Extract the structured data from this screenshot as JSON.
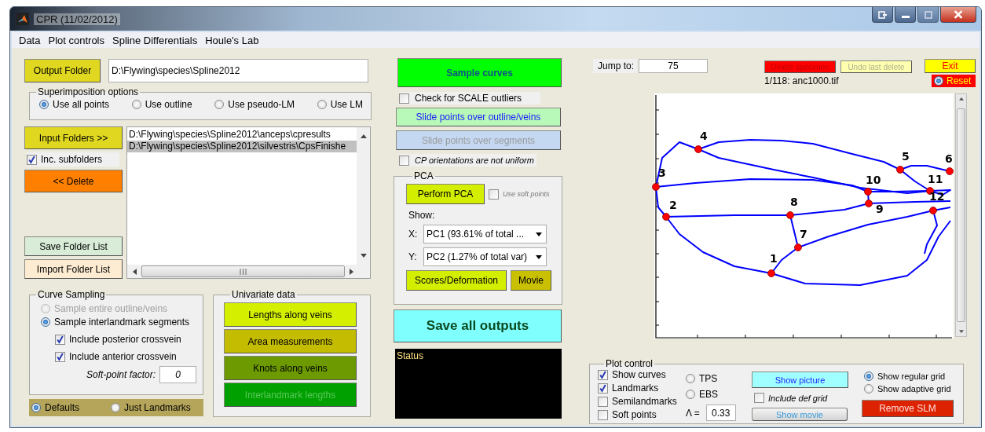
{
  "window": {
    "title": "CPR (11/02/2012)"
  },
  "menu": [
    "Data",
    "Plot controls",
    "Spline Differentials",
    "Houle's Lab"
  ],
  "output_folder": {
    "button": "Output Folder",
    "value": "D:\\Flywing\\species\\Spline2012"
  },
  "superimposition": {
    "title": "Superimposition options",
    "options": [
      {
        "label": "Use all points",
        "selected": true
      },
      {
        "label": "Use outline",
        "selected": false
      },
      {
        "label": "Use pseudo-LM",
        "selected": false
      },
      {
        "label": "Use LM",
        "selected": false
      }
    ]
  },
  "folders": {
    "input_button": "Input Folders >>",
    "subfolders": {
      "label": "Inc. subfolders",
      "checked": true
    },
    "delete_button": "<< Delete",
    "save_button": "Save Folder List",
    "import_button": "Import Folder List",
    "list": [
      {
        "path": "D:\\Flywing\\species\\Spline2012\\anceps\\cpresults",
        "selected": false
      },
      {
        "path": "D:\\Flywing\\species\\Spline2012\\silvestris\\CpsFinishe",
        "selected": true
      }
    ]
  },
  "curve_sampling": {
    "title": "Curve Sampling",
    "options": [
      {
        "label": "Sample entire outline/veins",
        "selected": false,
        "disabled": true
      },
      {
        "label": "Sample interlandmark segments",
        "selected": true,
        "disabled": false
      }
    ],
    "checks": [
      {
        "label": "Include posterior crossvein",
        "checked": true
      },
      {
        "label": "Include anterior crossvein",
        "checked": true
      }
    ],
    "soft_point_factor": {
      "label": "Soft-point factor:",
      "value": "0"
    },
    "presets": [
      {
        "label": "Defaults",
        "selected": true
      },
      {
        "label": "Just Landmarks",
        "selected": false
      }
    ]
  },
  "univariate": {
    "title": "Univariate data",
    "buttons": [
      {
        "label": "Lengths along veins",
        "color": "#d4f000",
        "disabled": false
      },
      {
        "label": "Area measurements",
        "color": "#c4bc00",
        "disabled": false
      },
      {
        "label": "Knots along veins",
        "color": "#6c9a00",
        "disabled": false
      },
      {
        "label": "Interlandmark lengths",
        "color": "#00a000",
        "disabled": true
      }
    ]
  },
  "sample_curves": "Sample curves",
  "scale_check": {
    "label": "Check for SCALE outliers",
    "checked": false
  },
  "slide_outline": {
    "label": "Slide points over outline/veins",
    "disabled": false
  },
  "slide_segments": {
    "label": "Slide points over segments",
    "disabled": true
  },
  "cp_check": {
    "label": "CP orientations are not uniform",
    "checked": false
  },
  "pca": {
    "title": "PCA",
    "perform": "Perform PCA",
    "soft_points": {
      "label": "Use soft points",
      "checked": false
    },
    "show_label": "Show:",
    "x": {
      "label": "X:",
      "value": "PC1 (93.61% of total ..."
    },
    "y": {
      "label": "Y:",
      "value": "PC2 (1.27% of total var)"
    },
    "scores": "Scores/Deformation",
    "movie": "Movie"
  },
  "save_all": "Save all outputs",
  "status": "Status",
  "jump": {
    "label": "Jump to:",
    "value": "75"
  },
  "delete_specimen": {
    "label": "Delete specimen",
    "disabled": true
  },
  "undo_delete": {
    "label": "Undo last delete",
    "disabled": true
  },
  "exit": "Exit",
  "reset": {
    "label": "Reset",
    "selected": true
  },
  "specimen": "1/118: anc1000.tif",
  "plot": {
    "landmarks": [
      "1",
      "2",
      "3",
      "4",
      "5",
      "6",
      "7",
      "8",
      "9",
      "10",
      "11",
      "12"
    ]
  },
  "plot_control": {
    "title": "Plot control",
    "checks": [
      {
        "label": "Show curves",
        "checked": true
      },
      {
        "label": "Landmarks",
        "checked": true
      },
      {
        "label": "Semilandmarks",
        "checked": false
      },
      {
        "label": "Soft points",
        "checked": false
      }
    ],
    "morph": [
      {
        "label": "TPS",
        "selected": false
      },
      {
        "label": "EBS",
        "selected": false
      }
    ],
    "lambda": {
      "label": "Λ =",
      "value": "0.33"
    },
    "show_picture": "Show picture",
    "def_grid": {
      "label": "Include def grid",
      "checked": false
    },
    "show_movie": "Show movie",
    "grids": [
      {
        "label": "Show regular grid",
        "selected": true
      },
      {
        "label": "Show adaptive grid",
        "selected": false
      }
    ],
    "remove_slm": "Remove SLM"
  }
}
